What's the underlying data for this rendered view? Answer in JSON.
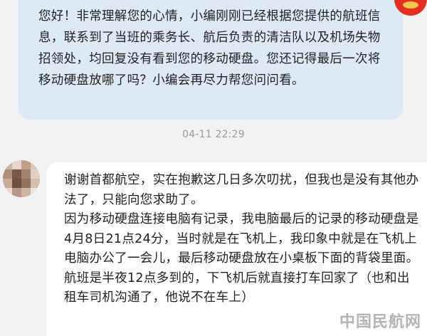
{
  "agent_message": {
    "text": "您好！非常理解您的心情，小编刚刚已经根据您提供的航班信息，联系到了当班的乘务长、航后负责的清洁队以及机场失物招领处，均回复没有看到您的移动硬盘。您还记得最后一次将移动硬盘放哪了吗？小编会再尽力帮您问问看。",
    "bubble_color": "#dde9f7"
  },
  "timestamp": "04-11 22:29",
  "user_message": {
    "paragraphs": [
      "谢谢首都航空，实在抱歉这几日多次叨扰，但我也是没有其他办法了，只能向您求助了。",
      "因为移动硬盘连接电脑有记录，我电脑最后的记录的移动硬盘是4月8日21点24分，当时就是在飞机上，我印象中就是在飞机上电脑办公了一会儿，最后移动硬盘放在小桌板下面的背袋里面。",
      "航班是半夜12点多到的，下飞机后就直接打车回家了（也和出租车司机沟通了，他说不在车上）"
    ],
    "bubble_color": "#ffffff"
  },
  "watermark": "中国民航网",
  "colors": {
    "background": "#f2f2f4",
    "timestamp": "#9a9a9a",
    "agent_avatar": "#e52d21"
  },
  "icons": {
    "agent_avatar": "airline-logo-avatar",
    "user_avatar": "pixelated-avatar"
  }
}
